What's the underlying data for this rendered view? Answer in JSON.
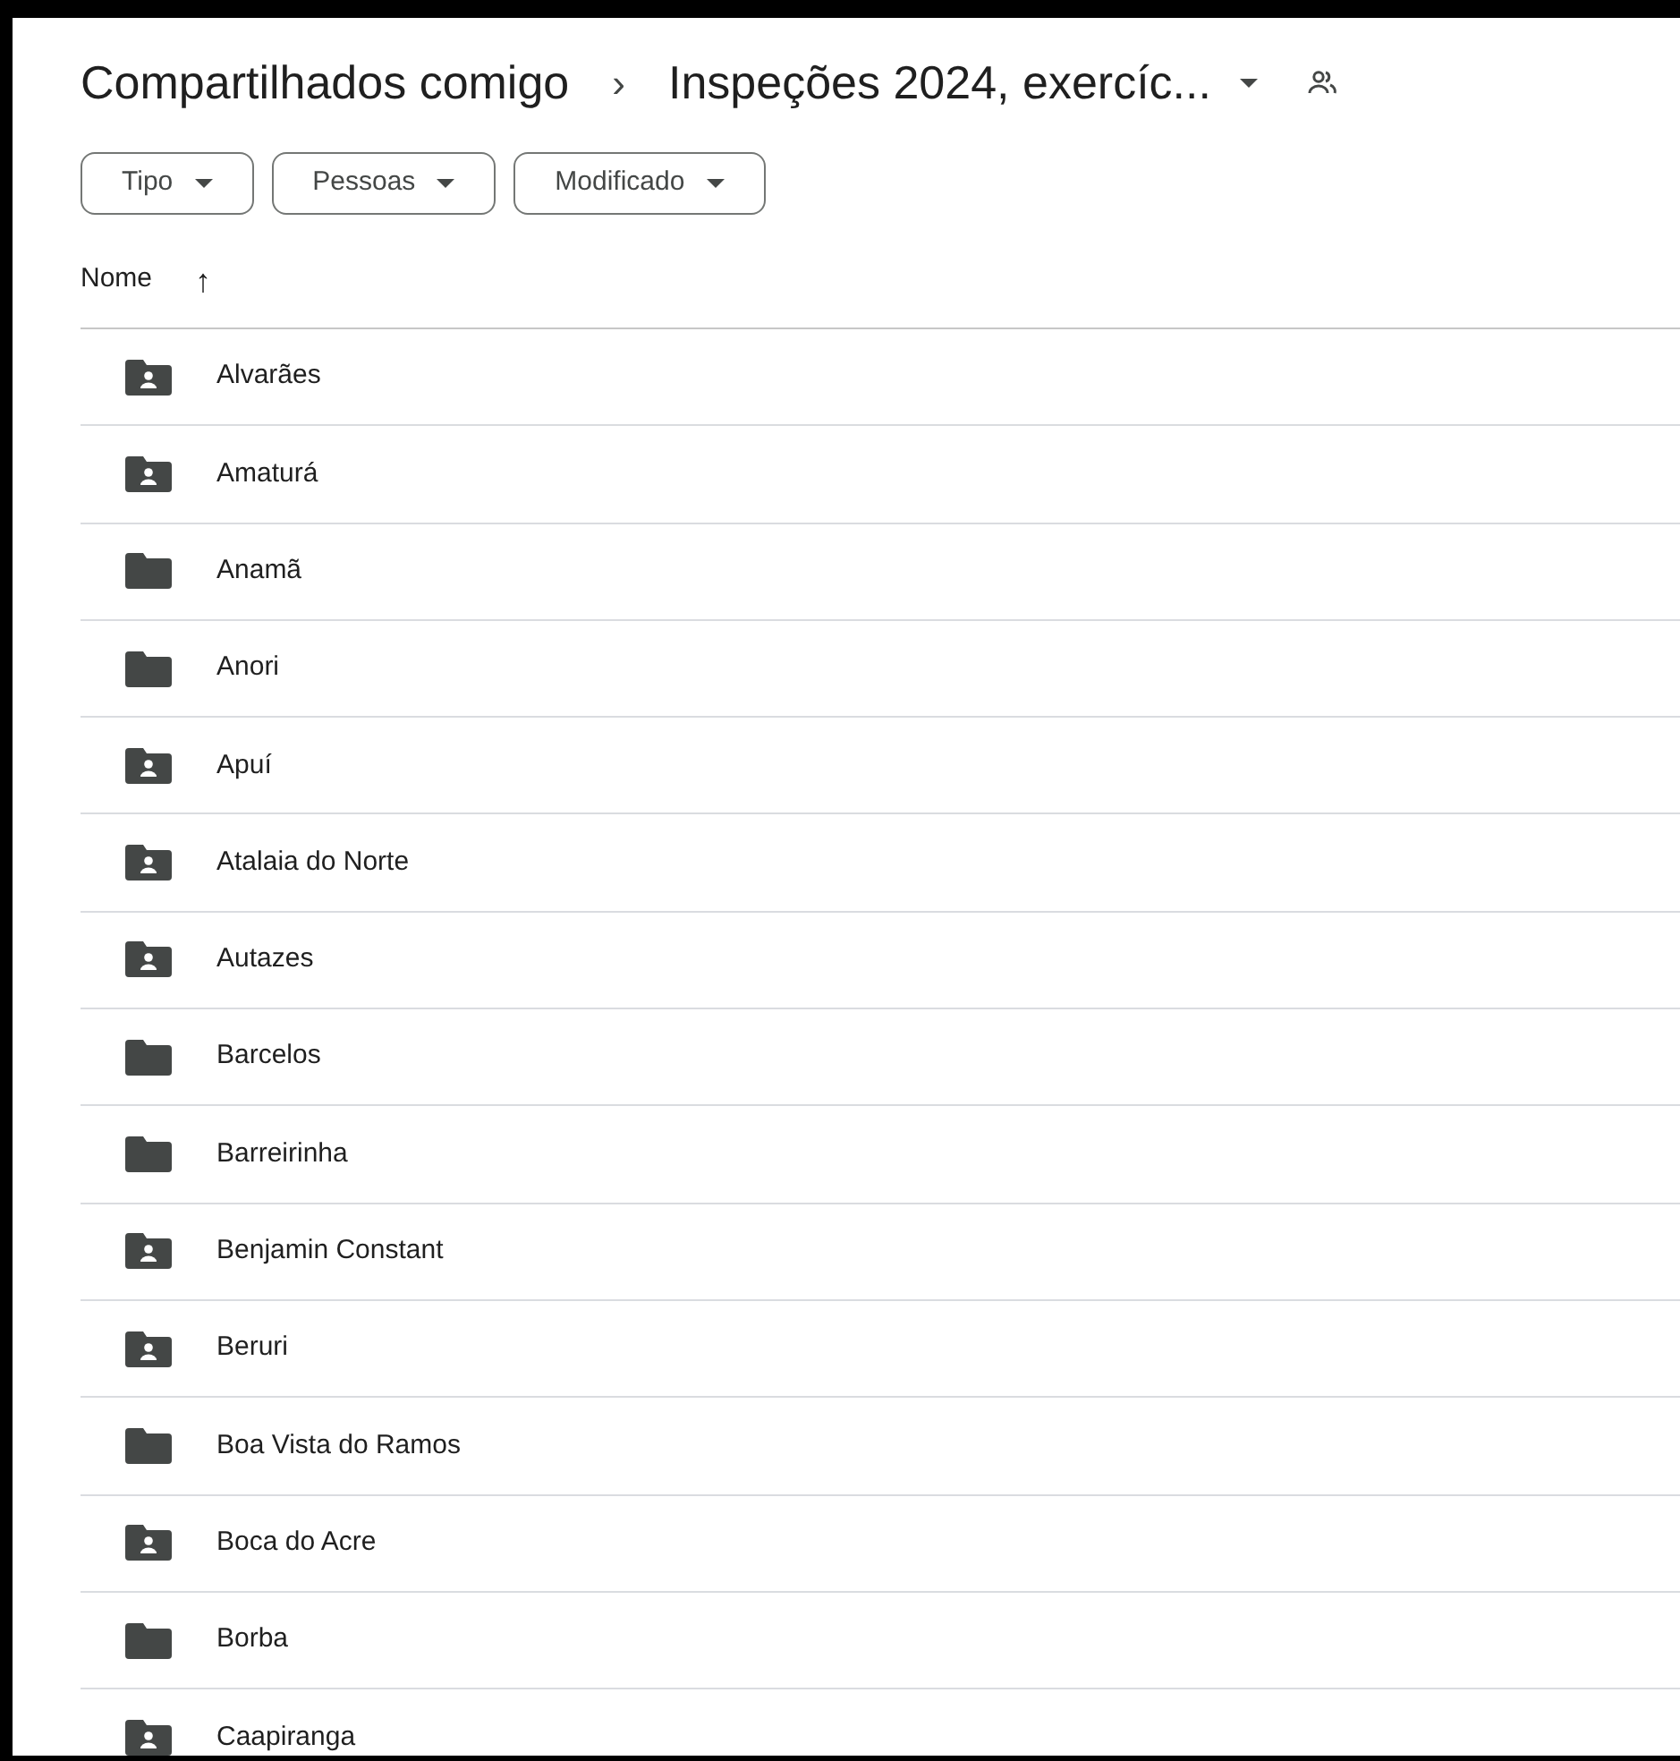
{
  "breadcrumb": {
    "parent": "Compartilhados comigo",
    "separator": "›",
    "current": "Inspeções 2024, exercíc..."
  },
  "filters": [
    {
      "label": "Tipo"
    },
    {
      "label": "Pessoas"
    },
    {
      "label": "Modificado"
    }
  ],
  "table": {
    "column": "Nome",
    "sort_arrow": "↑",
    "rows": [
      {
        "name": "Alvarães",
        "kind": "shared"
      },
      {
        "name": "Amaturá",
        "kind": "shared"
      },
      {
        "name": "Anamã",
        "kind": "folder"
      },
      {
        "name": "Anori",
        "kind": "folder"
      },
      {
        "name": "Apuí",
        "kind": "shared"
      },
      {
        "name": "Atalaia do Norte",
        "kind": "shared"
      },
      {
        "name": "Autazes",
        "kind": "shared"
      },
      {
        "name": "Barcelos",
        "kind": "folder"
      },
      {
        "name": "Barreirinha",
        "kind": "folder"
      },
      {
        "name": "Benjamin Constant",
        "kind": "shared"
      },
      {
        "name": "Beruri",
        "kind": "shared"
      },
      {
        "name": "Boa Vista do Ramos",
        "kind": "folder"
      },
      {
        "name": "Boca do Acre",
        "kind": "shared"
      },
      {
        "name": "Borba",
        "kind": "folder"
      },
      {
        "name": "Caapiranga",
        "kind": "shared"
      }
    ]
  }
}
